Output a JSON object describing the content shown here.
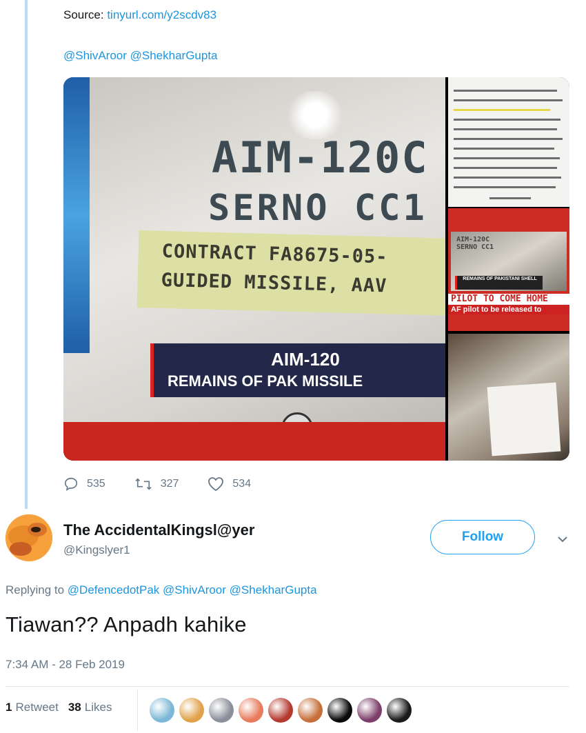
{
  "prev_tweet": {
    "source_label": "Source:",
    "source_link": "tinyurl.com/y2scdv83",
    "mentions": "@ShivAroor @ShekharGupta",
    "media": {
      "main_stencil_line1": "AIM-120C",
      "main_stencil_line2": "SERNO CC1",
      "main_label_line1": "CONTRACT FA8675-05-",
      "main_label_line2": "GUIDED MISSILE, AAV",
      "main_caption_title": "AIM-120",
      "main_caption_sub": "REMAINS OF PAK MISSILE",
      "tv_stencil": "AIM-120C\nSERNO CC1",
      "tv_label": "REMAINS OF PAKISTANI SHELL",
      "tv_ticker": "PILOT TO COME HOME",
      "tv_ticker2": "AF pilot to be released to"
    },
    "actions": {
      "replies": "535",
      "retweets": "327",
      "likes": "534"
    }
  },
  "reply": {
    "display_name": "The AccidentalKingsl@yer",
    "handle": "@Kingslyer1",
    "follow_label": "Follow",
    "replying_prefix": "Replying to",
    "replying_to": "@DefencedotPak @ShivAroor @ShekharGupta",
    "text": "Tiawan?? Anpadh kahike",
    "timestamp": "7:34 AM - 28 Feb 2019",
    "retweet_count": "1",
    "retweet_label": "Retweet",
    "like_count": "38",
    "like_label": "Likes"
  },
  "colors": {
    "accent": "#1da1f2",
    "link": "#1b95e0",
    "muted": "#657786",
    "thread_line": "#b8dcf5"
  },
  "likers": [
    {
      "icon": "avatar-1",
      "color": "#7bb7d6"
    },
    {
      "icon": "avatar-2",
      "color": "#e0a14a"
    },
    {
      "icon": "avatar-3",
      "color": "#8b8f9a"
    },
    {
      "icon": "avatar-4",
      "color": "#e77b5c"
    },
    {
      "icon": "avatar-5",
      "color": "#b43a2e"
    },
    {
      "icon": "avatar-6",
      "color": "#c66f3a"
    },
    {
      "icon": "avatar-7",
      "color": "#0a0a0a"
    },
    {
      "icon": "avatar-8",
      "color": "#7d3f6a"
    },
    {
      "icon": "avatar-9",
      "color": "#1a1a1a"
    }
  ]
}
